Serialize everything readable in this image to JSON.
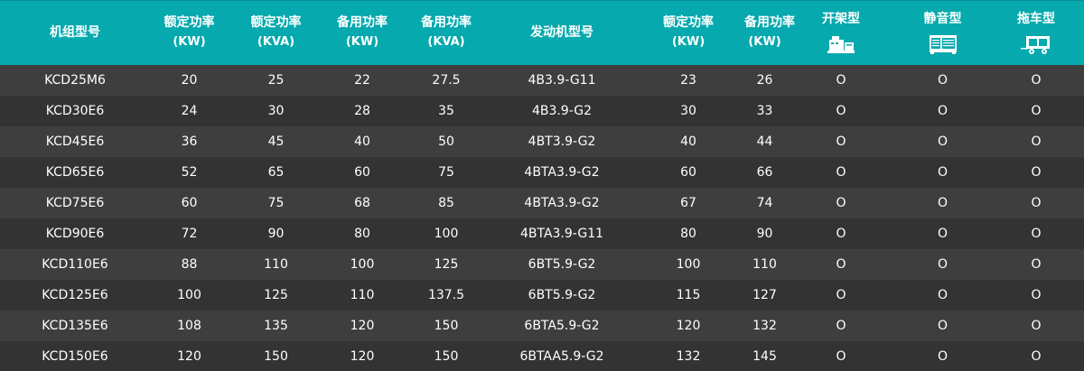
{
  "table": {
    "headers": [
      {
        "label": "机组型号",
        "unit": ""
      },
      {
        "label": "额定功率",
        "unit": "(KW)"
      },
      {
        "label": "额定功率",
        "unit": "(KVA)"
      },
      {
        "label": "备用功率",
        "unit": "(KW)"
      },
      {
        "label": "备用功率",
        "unit": "(KVA)"
      },
      {
        "label": "发动机型号",
        "unit": ""
      },
      {
        "label": "额定功率",
        "unit": "(KW)"
      },
      {
        "label": "备用功率",
        "unit": "(KW)"
      },
      {
        "label": "开架型",
        "icon": "open-frame-generator-icon"
      },
      {
        "label": "静音型",
        "icon": "silent-generator-icon"
      },
      {
        "label": "拖车型",
        "icon": "trailer-generator-icon"
      }
    ],
    "rows": [
      [
        "KCD25M6",
        "20",
        "25",
        "22",
        "27.5",
        "4B3.9-G11",
        "23",
        "26",
        "O",
        "O",
        "O"
      ],
      [
        "KCD30E6",
        "24",
        "30",
        "28",
        "35",
        "4B3.9-G2",
        "30",
        "33",
        "O",
        "O",
        "O"
      ],
      [
        "KCD45E6",
        "36",
        "45",
        "40",
        "50",
        "4BT3.9-G2",
        "40",
        "44",
        "O",
        "O",
        "O"
      ],
      [
        "KCD65E6",
        "52",
        "65",
        "60",
        "75",
        "4BTA3.9-G2",
        "60",
        "66",
        "O",
        "O",
        "O"
      ],
      [
        "KCD75E6",
        "60",
        "75",
        "68",
        "85",
        "4BTA3.9-G2",
        "67",
        "74",
        "O",
        "O",
        "O"
      ],
      [
        "KCD90E6",
        "72",
        "90",
        "80",
        "100",
        "4BTA3.9-G11",
        "80",
        "90",
        "O",
        "O",
        "O"
      ],
      [
        "KCD110E6",
        "88",
        "110",
        "100",
        "125",
        "6BT5.9-G2",
        "100",
        "110",
        "O",
        "O",
        "O"
      ],
      [
        "KCD125E6",
        "100",
        "125",
        "110",
        "137.5",
        "6BT5.9-G2",
        "115",
        "127",
        "O",
        "O",
        "O"
      ],
      [
        "KCD135E6",
        "108",
        "135",
        "120",
        "150",
        "6BTA5.9-G2",
        "120",
        "132",
        "O",
        "O",
        "O"
      ],
      [
        "KCD150E6",
        "120",
        "150",
        "120",
        "150",
        "6BTAA5.9-G2",
        "132",
        "145",
        "O",
        "O",
        "O"
      ]
    ]
  },
  "colors": {
    "header_bg": "#06a9ad",
    "row_odd": "#3e3e3e",
    "row_even": "#333333",
    "text": "#ffffff"
  }
}
